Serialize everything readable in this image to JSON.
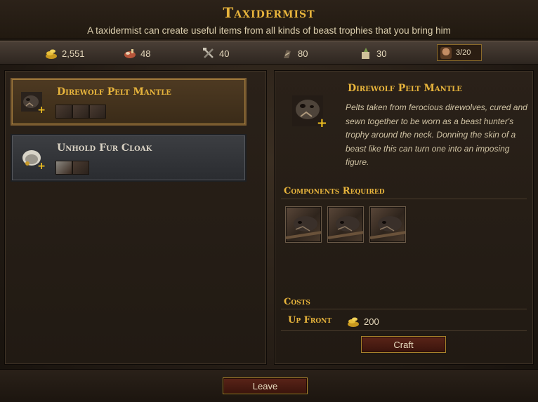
{
  "header": {
    "title": "Taxidermist",
    "subtitle": "A taxidermist can create useful items from all kinds of beast trophies that you bring him"
  },
  "resources": {
    "crowns": {
      "icon": "crowns-icon",
      "value": "2,551"
    },
    "provisions": {
      "icon": "provisions-icon",
      "value": "48"
    },
    "tools": {
      "icon": "tools-icon",
      "value": "40"
    },
    "medicine": {
      "icon": "medicine-icon",
      "value": "80"
    },
    "ammo": {
      "icon": "ammo-icon",
      "value": "30"
    },
    "roster": {
      "icon": "portrait-icon",
      "value": "3/20"
    }
  },
  "recipes": [
    {
      "name": "Direwolf Pelt Mantle",
      "selected": true,
      "components": 3
    },
    {
      "name": "Unhold Fur Cloak",
      "selected": false,
      "components": 2
    }
  ],
  "detail": {
    "name": "Direwolf Pelt Mantle",
    "description": "Pelts taken from ferocious direwolves, cured and sewn together to be worn as a beast hunter's trophy around the neck. Donning the skin of a beast like this can turn one into an imposing figure.",
    "components_heading": "Components Required",
    "components": [
      "direwolf-pelt",
      "direwolf-pelt",
      "direwolf-pelt"
    ],
    "costs_heading": "Costs",
    "upfront_label": "Up Front",
    "upfront_value": "200",
    "craft_label": "Craft"
  },
  "footer": {
    "leave_label": "Leave"
  },
  "colors": {
    "accent": "#e7b43c",
    "button": "#5a2418"
  }
}
